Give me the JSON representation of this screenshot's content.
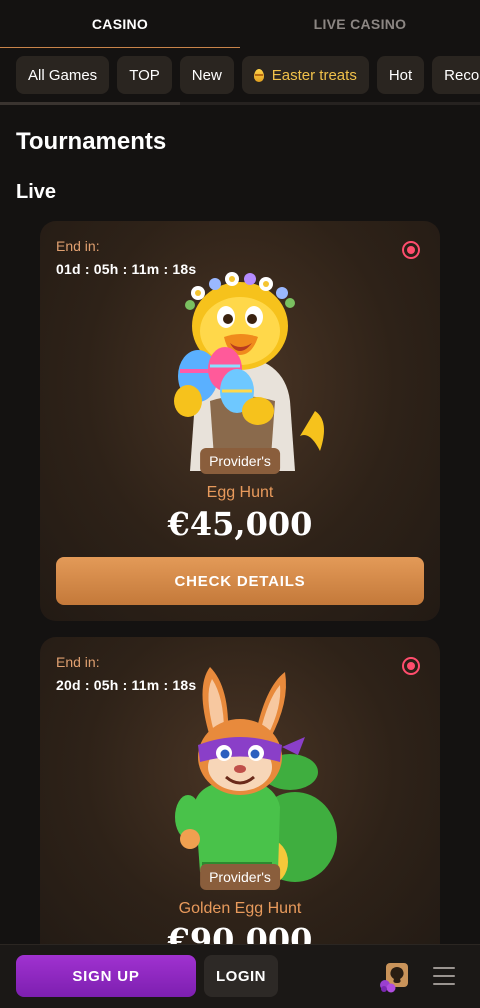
{
  "top_tabs": [
    {
      "label": "CASINO",
      "active": true
    },
    {
      "label": "LIVE CASINO",
      "active": false
    }
  ],
  "categories": [
    {
      "label": "All Games"
    },
    {
      "label": "TOP"
    },
    {
      "label": "New"
    },
    {
      "label": "Easter treats",
      "icon": "egg-icon"
    },
    {
      "label": "Hot"
    },
    {
      "label": "Reco"
    }
  ],
  "page": {
    "title": "Tournaments",
    "section": "Live"
  },
  "tournaments": [
    {
      "end_label": "End in:",
      "timer": "01d : 05h : 11m : 18s",
      "badge": "Provider's",
      "name": "Egg Hunt",
      "prize": "€45,000",
      "button": "CHECK DETAILS",
      "art": "easter-chick-with-eggs"
    },
    {
      "end_label": "End in:",
      "timer": "20d : 05h : 11m : 18s",
      "badge": "Provider's",
      "name": "Golden Egg Hunt",
      "prize": "€90,000",
      "art": "masked-bunny-with-sack"
    }
  ],
  "bottom_bar": {
    "signup": "SIGN UP",
    "login": "LOGIN",
    "menu_icon": "hamburger-menu-icon"
  },
  "colors": {
    "accent_orange": "#d38a4c",
    "signup_purple": "#9128c4",
    "live_red": "#ff4d6d"
  }
}
